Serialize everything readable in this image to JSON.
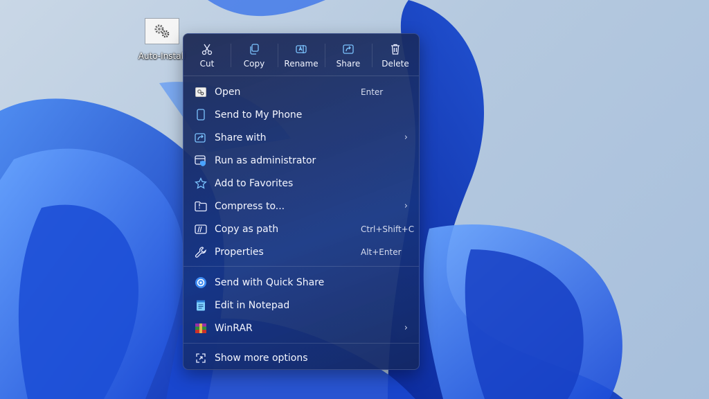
{
  "desktop": {
    "icon_label": "Auto-Install"
  },
  "menu": {
    "toolbar": [
      {
        "label": "Cut",
        "icon": "scissors-icon"
      },
      {
        "label": "Copy",
        "icon": "copy-icon"
      },
      {
        "label": "Rename",
        "icon": "rename-icon"
      },
      {
        "label": "Share",
        "icon": "share-icon"
      },
      {
        "label": "Delete",
        "icon": "trash-icon"
      }
    ],
    "items": [
      {
        "label": "Open",
        "shortcut": "Enter",
        "icon": "open-icon"
      },
      {
        "label": "Send to My Phone",
        "icon": "phone-icon"
      },
      {
        "label": "Share with",
        "icon": "share-with-icon",
        "submenu": true
      },
      {
        "label": "Run as administrator",
        "icon": "shield-icon"
      },
      {
        "label": "Add to Favorites",
        "icon": "star-icon"
      },
      {
        "label": "Compress to...",
        "icon": "folder-zip-icon",
        "submenu": true
      },
      {
        "label": "Copy as path",
        "shortcut": "Ctrl+Shift+C",
        "icon": "copy-path-icon"
      },
      {
        "label": "Properties",
        "shortcut": "Alt+Enter",
        "icon": "wrench-icon"
      },
      {
        "label": "Send with Quick Share",
        "icon": "quick-share-icon"
      },
      {
        "label": "Edit in Notepad",
        "icon": "notepad-icon"
      },
      {
        "label": "WinRAR",
        "icon": "winrar-icon",
        "submenu": true
      },
      {
        "label": "Show more options",
        "icon": "more-options-icon"
      }
    ]
  },
  "colors": {
    "accent": "#4aa3ff",
    "menu_bg": "#1c2a5a",
    "wallpaper_blue": "#1f5fe0"
  }
}
